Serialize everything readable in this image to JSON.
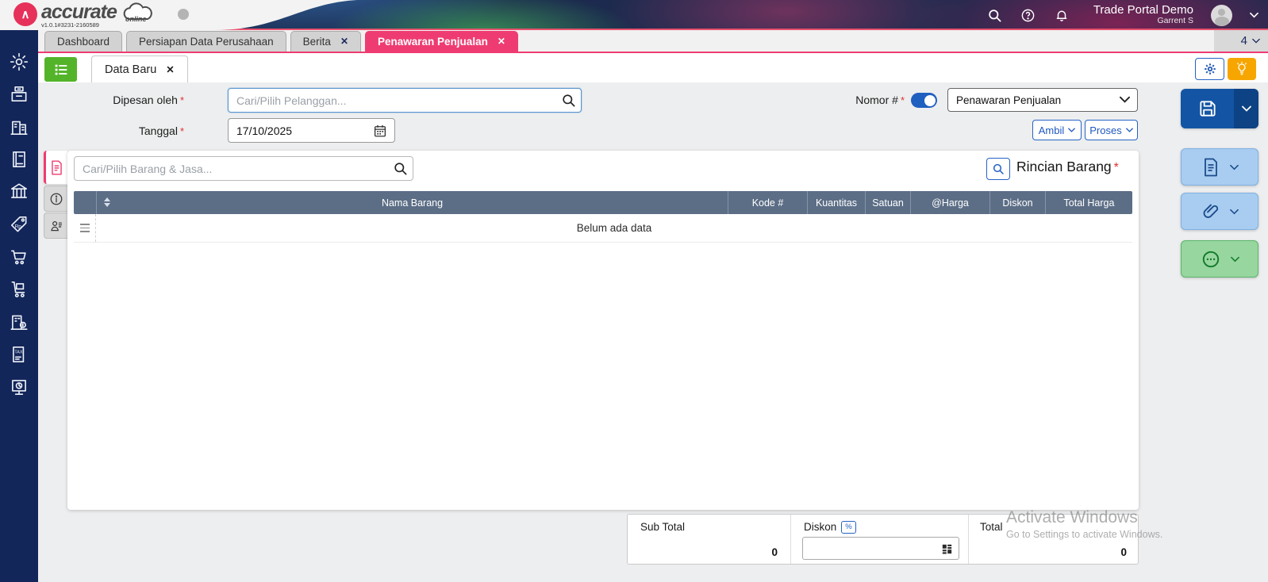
{
  "colors": {
    "accent_pink": "#ee3c72",
    "navy": "#13265a",
    "blue": "#2563c4",
    "save_blue": "#1355a4",
    "light_blue": "#a9cdf0",
    "green_button": "#97d69f",
    "toolbar_green": "#53b42a",
    "amber": "#f7a600",
    "table_header": "#5c6e86"
  },
  "header": {
    "logo_text": "accurate",
    "logo_online": "online",
    "version": "v1.0.1#3231-2160589",
    "account_name": "Trade Portal Demo",
    "user_name": "Garrent S",
    "icons": [
      "search-icon",
      "help-icon",
      "notifications-icon",
      "avatar",
      "chevron-down-icon"
    ]
  },
  "tab_bar": {
    "close_glyph": "✕",
    "tabs": [
      {
        "label": "Dashboard"
      },
      {
        "label": "Persiapan Data Perusahaan"
      },
      {
        "label": "Berita"
      },
      {
        "label": "Penawaran Penjualan"
      }
    ],
    "open_tabs_count": "4"
  },
  "sidebar": {
    "icons": [
      "settings",
      "cash-register",
      "company",
      "journal",
      "bank",
      "pricing-tag",
      "shopping-cart",
      "delivery-trolley",
      "fixed-asset",
      "tax-document",
      "report"
    ]
  },
  "toolbar": {
    "inner_tab_label": "Data Baru",
    "icons": [
      "list-menu",
      "settings-gear",
      "lightbulb"
    ]
  },
  "form": {
    "required_mark": "*",
    "dipesan_oleh_label": "Dipesan oleh",
    "customer_placeholder": "Cari/Pilih Pelanggan...",
    "tanggal_label": "Tanggal",
    "tanggal_value": "17/10/2025",
    "nomor_label": "Nomor #",
    "nomor_toggle_state": "on",
    "template_selected": "Penawaran Penjualan",
    "ambil_label": "Ambil",
    "proses_label": "Proses"
  },
  "side_tabs": {
    "icons": [
      "document",
      "info",
      "salesman"
    ]
  },
  "items_section": {
    "search_placeholder": "Cari/Pilih Barang & Jasa...",
    "title": "Rincian Barang",
    "table": {
      "columns": [
        "Nama Barang",
        "Kode #",
        "Kuantitas",
        "Satuan",
        "@Harga",
        "Diskon",
        "Total Harga"
      ],
      "empty_text": "Belum ada data"
    }
  },
  "actions": {
    "icons": [
      "save-floppy",
      "document",
      "attachment-paperclip",
      "comment-ellipsis"
    ]
  },
  "totals": {
    "sub_total_label": "Sub Total",
    "sub_total_value": "0",
    "diskon_label": "Diskon",
    "diskon_badge": "%",
    "total_label": "Total",
    "total_value": "0"
  },
  "watermark": {
    "line1": "Activate Windows",
    "line2": "Go to Settings to activate Windows."
  }
}
